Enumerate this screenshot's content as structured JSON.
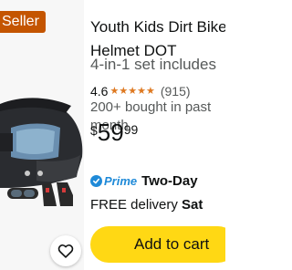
{
  "badge": {
    "label": "Seller"
  },
  "product": {
    "title_line1": "Youth Kids Dirt Bike",
    "title_line2": "Helmet DOT",
    "subtitle": "4-in-1 set includes",
    "rating_value": "4.6",
    "rating_stars": 4.5,
    "rating_count": "(915)",
    "bought_text": "200+ bought in past month",
    "price": {
      "symbol": "$",
      "whole": "59",
      "fraction": "99"
    },
    "prime_label": "Prime",
    "prime_speed": "Two-Day",
    "delivery_prefix": "FREE delivery",
    "delivery_day": "Sat",
    "add_to_cart": "Add to cart"
  },
  "icons": {
    "favorite": "heart-outline-icon",
    "prime": "check-circle-icon",
    "stars": "star-icon"
  },
  "colors": {
    "badge": "#c45500",
    "star": "#de7921",
    "prime": "#1f8ad8",
    "button": "#ffd814"
  }
}
